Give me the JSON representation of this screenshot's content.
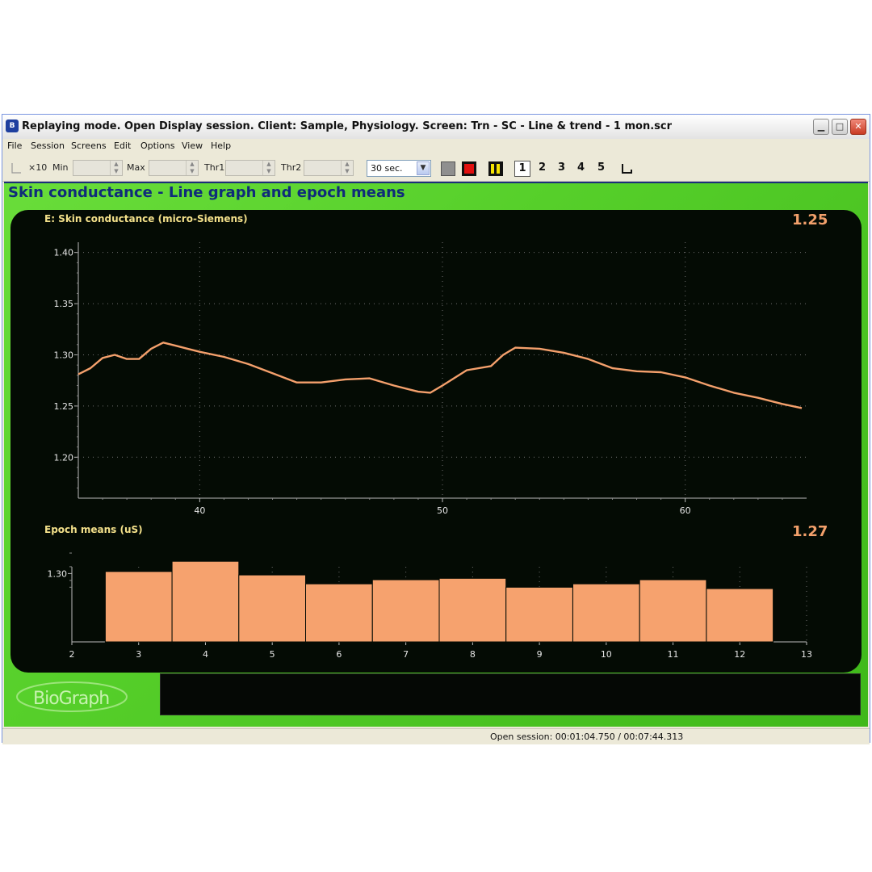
{
  "window": {
    "title": "Replaying mode. Open Display session. Client: Sample, Physiology. Screen: Trn - SC - Line & trend - 1 mon.scr",
    "app_icon": "biograph-app-icon"
  },
  "menu": [
    "File",
    "Session",
    "Screens",
    "Edit",
    "Options",
    "View",
    "Help"
  ],
  "toolbar": {
    "scale_label": "×10",
    "min_label": "Min",
    "max_label": "Max",
    "thr1_label": "Thr1",
    "thr2_label": "Thr2",
    "timebase": "30 sec.",
    "screen_numbers": [
      "1",
      "2",
      "3",
      "4",
      "5"
    ],
    "selected_screen": "1"
  },
  "screen": {
    "title": "Skin conductance - Line graph and epoch means"
  },
  "line_chart": {
    "label": "E: Skin conductance (micro-Siemens)",
    "current_value": "1.25"
  },
  "bar_chart": {
    "label": "Epoch means (uS)",
    "current_value": "1.27"
  },
  "logo_text": "BioGraph",
  "status": {
    "text": "Open session: 00:01:04.750 / 00:07:44.313"
  },
  "colors": {
    "trace": "#f4a06c",
    "bars": "#f6a26e",
    "panel_bg": "#040b04",
    "screen_bg": "#5ad42c",
    "title_blue": "#0f2b7a"
  },
  "chart_data": [
    {
      "type": "line",
      "title": "E: Skin conductance (micro-Siemens)",
      "xlim": [
        35,
        65
      ],
      "ylim": [
        1.16,
        1.41
      ],
      "x_ticks": [
        40,
        50,
        60
      ],
      "y_ticks": [
        1.2,
        1.25,
        1.3,
        1.35,
        1.4
      ],
      "y_tick_labels": [
        "1.20",
        "1.25",
        "1.30",
        "1.35",
        "1.40"
      ],
      "grid": true,
      "series": [
        {
          "x": [
            35.0,
            35.5,
            36.0,
            36.5,
            37.0,
            37.5,
            38.0,
            38.5,
            39.0,
            39.5,
            40.0,
            41.0,
            42.0,
            43.0,
            44.0,
            45.0,
            46.0,
            47.0,
            48.0,
            49.0,
            49.5,
            50.0,
            51.0,
            52.0,
            52.5,
            53.0,
            54.0,
            55.0,
            56.0,
            57.0,
            58.0,
            59.0,
            60.0,
            61.0,
            62.0,
            63.0,
            64.0,
            64.8
          ],
          "y": [
            1.281,
            1.287,
            1.297,
            1.3,
            1.296,
            1.296,
            1.306,
            1.312,
            1.309,
            1.306,
            1.303,
            1.298,
            1.291,
            1.282,
            1.273,
            1.273,
            1.276,
            1.277,
            1.27,
            1.264,
            1.263,
            1.27,
            1.285,
            1.289,
            1.3,
            1.307,
            1.306,
            1.302,
            1.296,
            1.287,
            1.284,
            1.283,
            1.278,
            1.27,
            1.263,
            1.258,
            1.252,
            1.248
          ]
        }
      ]
    },
    {
      "type": "bar",
      "title": "Epoch means (uS)",
      "xlim": [
        2,
        13
      ],
      "x_ticks": [
        2,
        3,
        4,
        5,
        6,
        7,
        8,
        9,
        10,
        11,
        12,
        13
      ],
      "y_ticks": [
        1.3
      ],
      "y_tick_labels": [
        "1.30"
      ],
      "ylim": [
        1.2,
        1.33
      ],
      "categories": [
        3,
        4,
        5,
        6,
        7,
        8,
        9,
        10,
        11,
        12
      ],
      "values": [
        1.303,
        1.318,
        1.298,
        1.285,
        1.291,
        1.293,
        1.28,
        1.285,
        1.291,
        1.278
      ]
    }
  ]
}
